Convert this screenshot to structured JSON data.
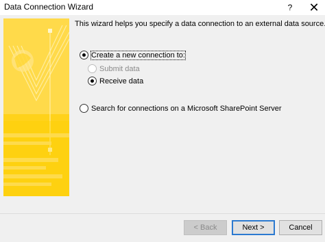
{
  "window": {
    "title": "Data Connection Wizard",
    "help_glyph": "?",
    "close_glyph": "✕"
  },
  "main": {
    "intro": "This wizard helps you specify a data connection to an external data source.",
    "options": {
      "create_new": {
        "label": "Create a new connection to:",
        "checked": true,
        "enabled": true
      },
      "submit_data": {
        "label": "Submit data",
        "checked": false,
        "enabled": false
      },
      "receive_data": {
        "label": "Receive data",
        "checked": true,
        "enabled": true
      },
      "sharepoint": {
        "label": "Search for connections on a Microsoft SharePoint Server",
        "checked": false,
        "enabled": true
      }
    }
  },
  "buttons": {
    "back": "< Back",
    "next": "Next >",
    "cancel": "Cancel"
  },
  "colors": {
    "panel_yellow": "#ffd21a",
    "panel_light": "#ffe98a",
    "accent_blue": "#2b79d0",
    "window_bg": "#f0f0f0"
  }
}
